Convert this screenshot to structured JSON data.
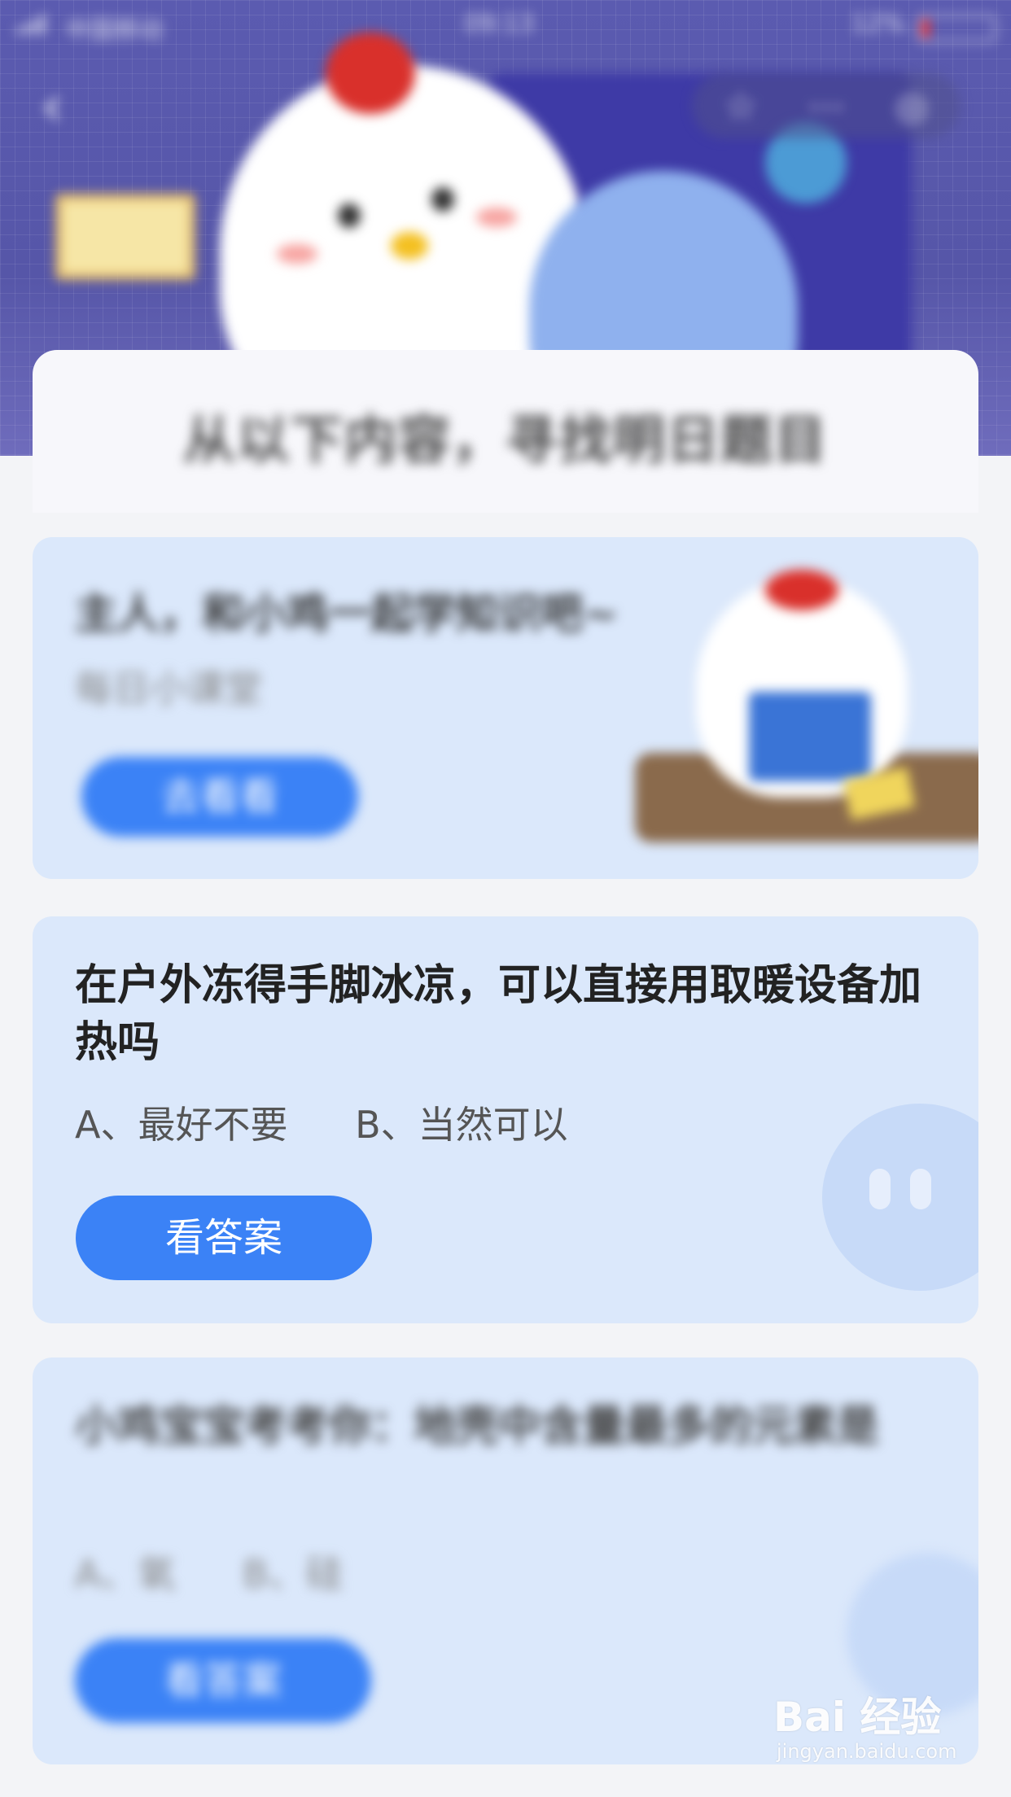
{
  "status_bar": {
    "carrier": "中国移动",
    "time": "09:13",
    "battery": "12%"
  },
  "header": {
    "back_icon": "chevron-left-icon",
    "actions": [
      "star-icon",
      "more-icon",
      "target-icon"
    ],
    "title": "从以下内容，寻找明日题目"
  },
  "cards": [
    {
      "title": "主人，和小鸡一起学知识吧~",
      "subtitle": "每日小课堂",
      "button": "去看看"
    },
    {
      "title": "在户外冻得手脚冰凉，可以直接用取暖设备加热吗",
      "option_a": "A、最好不要",
      "option_b": "B、当然可以",
      "button": "看答案"
    },
    {
      "title": "小鸡宝宝考考你：地壳中含量最多的元素是",
      "option_a": "A、氧",
      "option_b": "B、硅",
      "button": "看答案"
    }
  ],
  "watermark": {
    "logo": "Bai 经验",
    "url": "jingyan.baidu.com"
  },
  "colors": {
    "header_bg": "#5b5bb0",
    "card_bg": "#dbe8fb",
    "button_blue": "#3b82f6"
  }
}
